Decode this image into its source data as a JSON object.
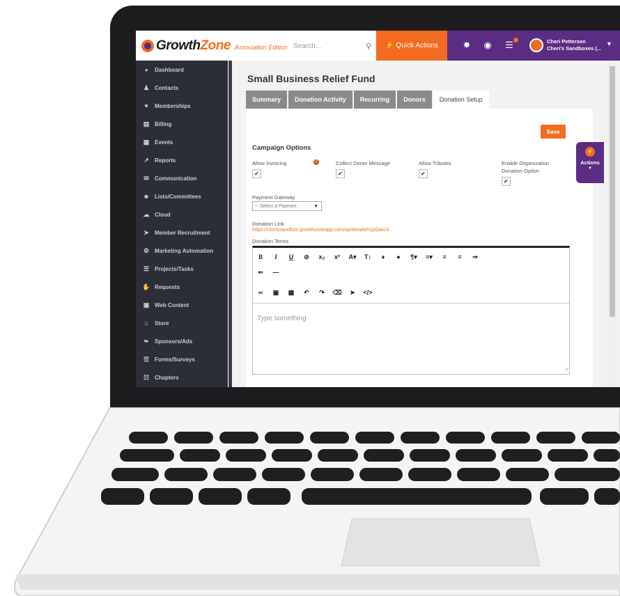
{
  "app": {
    "logo_word_1": "Growth",
    "logo_word_2": "Zone",
    "edition": "Association Edition",
    "search_placeholder": "Search...",
    "quick_actions_label": "Quick Actions",
    "user_name": "Cheri Petterson",
    "user_org": "Cheri's Sandboxes (...",
    "brand_orange": "#f26b21",
    "brand_purple": "#5a2d82"
  },
  "sidebar": {
    "items": [
      {
        "icon": "dashboard-icon",
        "label": "Dashboard"
      },
      {
        "icon": "contacts-icon",
        "label": "Contacts"
      },
      {
        "icon": "heart-icon",
        "label": "Memberships"
      },
      {
        "icon": "billing-icon",
        "label": "Billing"
      },
      {
        "icon": "calendar-icon",
        "label": "Events"
      },
      {
        "icon": "chart-icon",
        "label": "Reports"
      },
      {
        "icon": "mail-icon",
        "label": "Communication"
      },
      {
        "icon": "group-icon",
        "label": "Lists/Committees"
      },
      {
        "icon": "cloud-icon",
        "label": "Cloud"
      },
      {
        "icon": "megaphone-icon",
        "label": "Member Recruitment"
      },
      {
        "icon": "gear-icon",
        "label": "Marketing Automation"
      },
      {
        "icon": "tasks-icon",
        "label": "Projects/Tasks"
      },
      {
        "icon": "hand-icon",
        "label": "Requests"
      },
      {
        "icon": "web-icon",
        "label": "Web Content"
      },
      {
        "icon": "cart-icon",
        "label": "Store"
      },
      {
        "icon": "ribbon-icon",
        "label": "Sponsors/Ads"
      },
      {
        "icon": "forms-icon",
        "label": "Forms/Surveys"
      },
      {
        "icon": "org-chart-icon",
        "label": "Chapters"
      }
    ]
  },
  "main": {
    "title": "Small Business Relief Fund",
    "tabs": [
      {
        "label": "Summary",
        "active": false
      },
      {
        "label": "Donation Activity",
        "active": false
      },
      {
        "label": "Recurring",
        "active": false
      },
      {
        "label": "Donors",
        "active": false
      },
      {
        "label": "Donation Setup",
        "active": true
      }
    ],
    "save_label": "Save",
    "section_title": "Campaign Options",
    "options": {
      "allow_invoicing": "Allow Invoicing",
      "collect_donor_message": "Collect Donor Message",
      "allow_tributes": "Allow Tributes",
      "enable_org_line1": "Enable Organization",
      "enable_org_line2": "Donation Option"
    },
    "check_mark": "✔",
    "payment_gateway_label": "Payment Gateway",
    "payment_gateway_value": "-- Select a Paymen",
    "donation_link_label": "Donation Link",
    "donation_link_url": "https://cherissandbox.growthzoneapp.com/ap/donate/VjpGavLk",
    "donation_terms_label": "Donation Terms",
    "editor_placeholder": "Type something"
  },
  "actions_tab": {
    "label": "Actions"
  }
}
